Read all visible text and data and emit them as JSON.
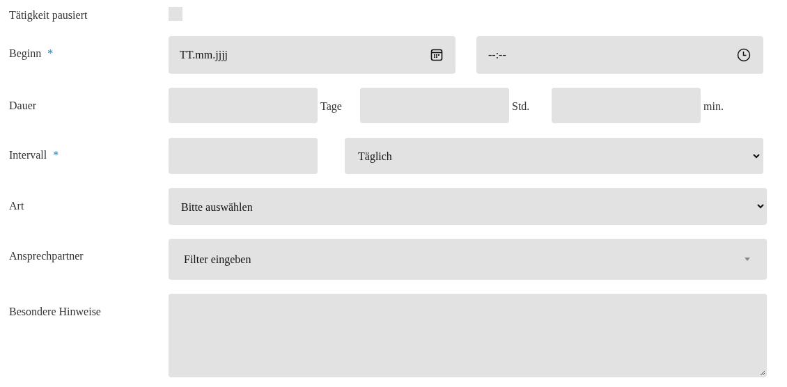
{
  "form": {
    "rows": [
      {
        "label": "Tätigkeit pausiert",
        "controls": [
          {
            "kind": "checkbox",
            "checked": false
          }
        ]
      },
      {
        "label": "Beginn",
        "required_mark": "*",
        "controls": [
          {
            "kind": "date",
            "placeholder": "TT.mm.jjjj"
          },
          {
            "kind": "time",
            "placeholder": "--:--"
          }
        ]
      },
      {
        "label": "Dauer",
        "controls": [
          {
            "kind": "number",
            "unit": "Tage"
          },
          {
            "kind": "number",
            "unit": "Std."
          },
          {
            "kind": "number",
            "unit": "min."
          }
        ]
      },
      {
        "label": "Intervall",
        "required_mark": "*",
        "controls": [
          {
            "kind": "number"
          },
          {
            "kind": "select",
            "value": "Täglich"
          }
        ]
      },
      {
        "label": "Art",
        "controls": [
          {
            "kind": "select",
            "value": "Bitte auswählen"
          }
        ]
      },
      {
        "label": "Ansprechpartner",
        "controls": [
          {
            "kind": "combobox",
            "placeholder": "Filter eingeben"
          }
        ]
      },
      {
        "label": "Besondere Hinweise",
        "controls": [
          {
            "kind": "textarea"
          }
        ]
      }
    ]
  }
}
